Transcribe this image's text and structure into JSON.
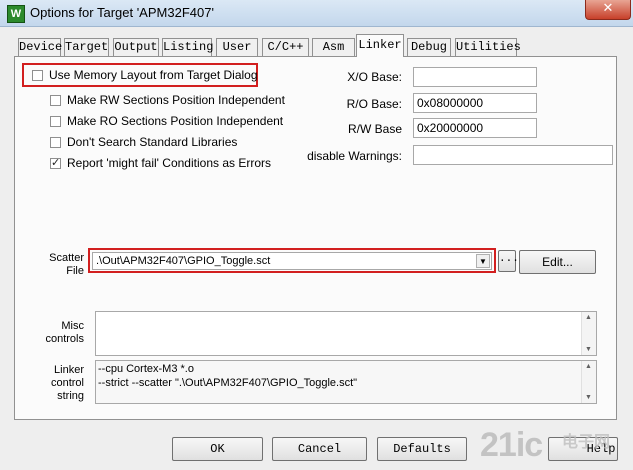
{
  "window": {
    "title": "Options for Target 'APM32F407'",
    "close_glyph": "✕",
    "app_icon_letter": "W"
  },
  "tabs": [
    {
      "label": "Device"
    },
    {
      "label": "Target"
    },
    {
      "label": "Output"
    },
    {
      "label": "Listing"
    },
    {
      "label": "User"
    },
    {
      "label": "C/C++"
    },
    {
      "label": "Asm"
    },
    {
      "label": "Linker",
      "active": true
    },
    {
      "label": "Debug"
    },
    {
      "label": "Utilities"
    }
  ],
  "options": {
    "use_memory_layout": {
      "label": "Use Memory Layout from Target Dialog",
      "checked": false
    },
    "rw_independent": {
      "label": "Make RW Sections Position Independent",
      "checked": false
    },
    "ro_independent": {
      "label": "Make RO Sections Position Independent",
      "checked": false
    },
    "dont_search_libs": {
      "label": "Don't Search Standard Libraries",
      "checked": false
    },
    "might_fail_errors": {
      "label": "Report 'might fail' Conditions as Errors",
      "checked": true
    }
  },
  "bases": {
    "xo": {
      "label": "X/O Base:",
      "value": ""
    },
    "ro": {
      "label": "R/O Base:",
      "value": "0x08000000"
    },
    "rw": {
      "label": "R/W Base",
      "value": "0x20000000"
    },
    "disable_warnings": {
      "label": "disable Warnings:",
      "value": ""
    }
  },
  "scatter": {
    "label_line1": "Scatter",
    "label_line2": "File",
    "value": ".\\Out\\APM32F407\\GPIO_Toggle.sct",
    "browse_label": "...",
    "edit_label": "Edit..."
  },
  "misc": {
    "label_line1": "Misc",
    "label_line2": "controls",
    "value": ""
  },
  "linker_string": {
    "label_line1": "Linker",
    "label_line2": "control",
    "label_line3": "string",
    "line1": "--cpu Cortex-M3 *.o",
    "line2": "--strict --scatter \".\\Out\\APM32F407\\GPIO_Toggle.sct\""
  },
  "buttons": {
    "ok": "OK",
    "cancel": "Cancel",
    "defaults": "Defaults",
    "help": "Help"
  },
  "watermark": {
    "text": "21ic",
    "cn_text": "电子网"
  },
  "colors": {
    "highlight_red": "#d21f1f",
    "title_bar": "#c3d7ec",
    "watermark": "#c8c8c8"
  }
}
